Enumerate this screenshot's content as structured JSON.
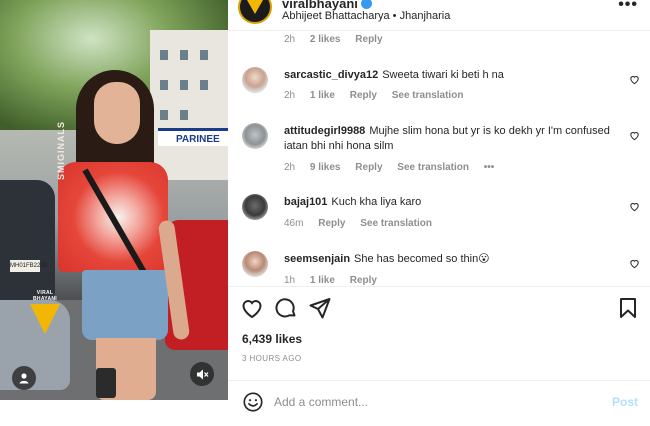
{
  "post": {
    "username": "viralbhayani",
    "subline": "Abhijeet Bhattacharya • Jhanjharia",
    "more": "•••"
  },
  "media": {
    "sign_text": "PARINEE",
    "shirt_text": "SMIGINALS",
    "plate_text": "MH01FB2229",
    "watermark_text": "VIRAL BHAYANI"
  },
  "comments": [
    {
      "username": "",
      "text": "",
      "time": "2h",
      "likes": "2 likes",
      "reply": "Reply",
      "see_translation": ""
    },
    {
      "username": "sarcastic_divya12",
      "text": "Sweeta tiwari ki beti h na",
      "time": "2h",
      "likes": "1 like",
      "reply": "Reply",
      "see_translation": "See translation"
    },
    {
      "username": "attitudegirl9988",
      "text": "Mujhe slim hona but yr is ko dekh yr I'm confused iatan bhi nhi hona silm",
      "time": "2h",
      "likes": "9 likes",
      "reply": "Reply",
      "see_translation": "See translation",
      "more": "•••"
    },
    {
      "username": "bajaj101",
      "text": "Kuch kha liya karo",
      "time": "46m",
      "likes": "",
      "reply": "Reply",
      "see_translation": "See translation"
    },
    {
      "username": "seemsenjain",
      "text": "She has becomed so thin😮",
      "time": "1h",
      "likes": "1 like",
      "reply": "Reply",
      "see_translation": ""
    }
  ],
  "stats": {
    "likes": "6,439 likes",
    "time_ago": "3 HOURS AGO"
  },
  "add_comment": {
    "placeholder": "Add a comment...",
    "post_label": "Post"
  },
  "colors": {
    "accent_blue": "#3897f0",
    "post_disabled": "#b2dffc",
    "muted": "#8e8e8e",
    "text": "#262626"
  }
}
